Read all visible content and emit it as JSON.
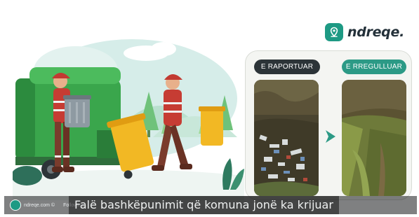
{
  "brand": {
    "name": "ndreqe.",
    "logo_icon": "location-pin-hex-icon",
    "color": "#1e9a84"
  },
  "compare": {
    "before_label": "E RAPORTUAR",
    "after_label": "E RREGULLUAR",
    "before_color": "#2c3438",
    "after_color": "#2c9a86",
    "arrow_icon": "chevron-right-icon"
  },
  "video": {
    "channel": "ndreqe.com ©",
    "follow_label": "Following",
    "caption": "Falë bashkëpunimit që komuna jonë ka krijuar"
  }
}
